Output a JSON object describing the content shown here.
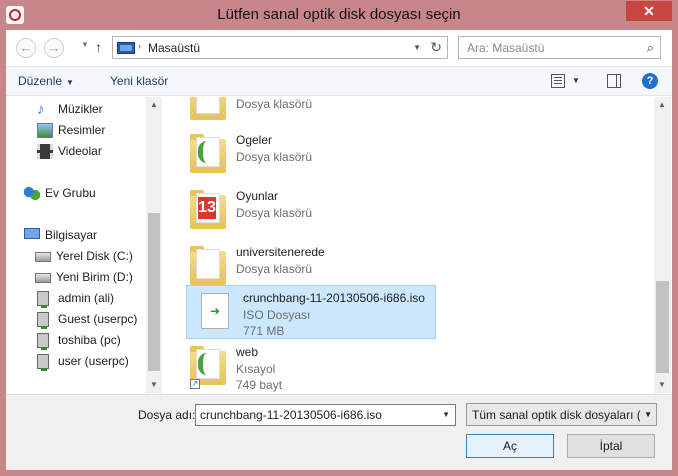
{
  "window": {
    "title": "Lütfen sanal optik disk dosyası seçin",
    "close_glyph": "✕"
  },
  "address": {
    "back_glyph": "←",
    "forward_glyph": "→",
    "up_glyph": "↑",
    "location": "Masaüstü",
    "search_placeholder": "Ara: Masaüstü"
  },
  "toolbar": {
    "organize_label": "Düzenle",
    "new_folder_label": "Yeni klasör"
  },
  "sidebar": {
    "items": [
      {
        "label": "Müzikler",
        "icon": "music-icon"
      },
      {
        "label": "Resimler",
        "icon": "pictures-icon"
      },
      {
        "label": "Videolar",
        "icon": "videos-icon"
      },
      {
        "label": "Ev Grubu",
        "icon": "homegroup-icon"
      },
      {
        "label": "Bilgisayar",
        "icon": "computer-icon"
      },
      {
        "label": "Yerel Disk (C:)",
        "icon": "local-disk-icon"
      },
      {
        "label": "Yeni Birim (D:)",
        "icon": "drive-icon"
      },
      {
        "label": "admin (ali)",
        "icon": "network-computer-icon"
      },
      {
        "label": "Guest (userpc)",
        "icon": "network-computer-icon"
      },
      {
        "label": "toshiba (pc)",
        "icon": "network-computer-icon"
      },
      {
        "label": "user (userpc)",
        "icon": "network-computer-icon"
      }
    ]
  },
  "files": [
    {
      "name": "",
      "type": "Dosya klasörü",
      "size": ""
    },
    {
      "name": "Ogeler",
      "type": "Dosya klasörü",
      "size": ""
    },
    {
      "name": "Oyunlar",
      "type": "Dosya klasörü",
      "size": ""
    },
    {
      "name": "universitenerede",
      "type": "Dosya klasörü",
      "size": ""
    },
    {
      "name": "crunchbang-11-20130506-i686.iso",
      "type": "ISO Dosyası",
      "size": "771 MB",
      "selected": true
    },
    {
      "name": "web",
      "type": "Kısayol",
      "size": "749 bayt"
    }
  ],
  "footer": {
    "filename_label": "Dosya adı:",
    "filename_value": "crunchbang-11-20130506-i686.iso",
    "filetype_value": "Tüm sanal optik disk dosyaları (",
    "open_label": "Aç",
    "cancel_label": "İptal"
  }
}
